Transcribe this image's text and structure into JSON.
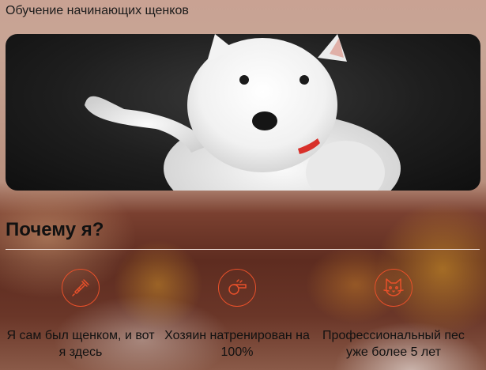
{
  "page": {
    "title": "Обучение начинающих щенков"
  },
  "hero": {
    "image": "white-puppy-photo"
  },
  "why": {
    "heading": "Почему я?",
    "features": [
      {
        "icon": "baby-bottle-icon",
        "text": "Я сам был щенком, и вот я здесь"
      },
      {
        "icon": "whistle-icon",
        "text": "Хозяин натренирован на 100%"
      },
      {
        "icon": "cat-face-icon",
        "text": "Профессиональный пес уже более 5 лет"
      }
    ]
  },
  "colors": {
    "accent": "#e8502a"
  }
}
